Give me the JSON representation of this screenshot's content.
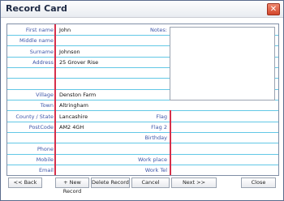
{
  "window": {
    "title": "Record Card"
  },
  "fields": {
    "first_name": {
      "label": "First name",
      "value": "John"
    },
    "middle_name": {
      "label": "Middle name",
      "value": ""
    },
    "surname": {
      "label": "Surname",
      "value": "Johnson"
    },
    "address": {
      "label": "Address",
      "value": "25 Grover Rise"
    },
    "village": {
      "label": "Village",
      "value": "Denston Farm"
    },
    "town": {
      "label": "Town",
      "value": "Altringham"
    },
    "county_state": {
      "label": "County / State",
      "value": "Lancashire"
    },
    "postcode": {
      "label": "PostCode",
      "value": "AM2 4GH"
    },
    "phone": {
      "label": "Phone",
      "value": ""
    },
    "mobile": {
      "label": "Mobile",
      "value": ""
    },
    "email": {
      "label": "Email",
      "value": ""
    }
  },
  "right_labels": {
    "notes": "Notes:",
    "flag": "Flag",
    "flag2": "Flag 2",
    "birthday": "Birthday",
    "work_place": "Work place",
    "work_tel": "Work Tel"
  },
  "buttons": {
    "back": "<< Back",
    "new_record": "+ New Record",
    "delete_record": "Delete Record",
    "cancel": "Cancel",
    "next": "Next >>",
    "close": "Close"
  }
}
